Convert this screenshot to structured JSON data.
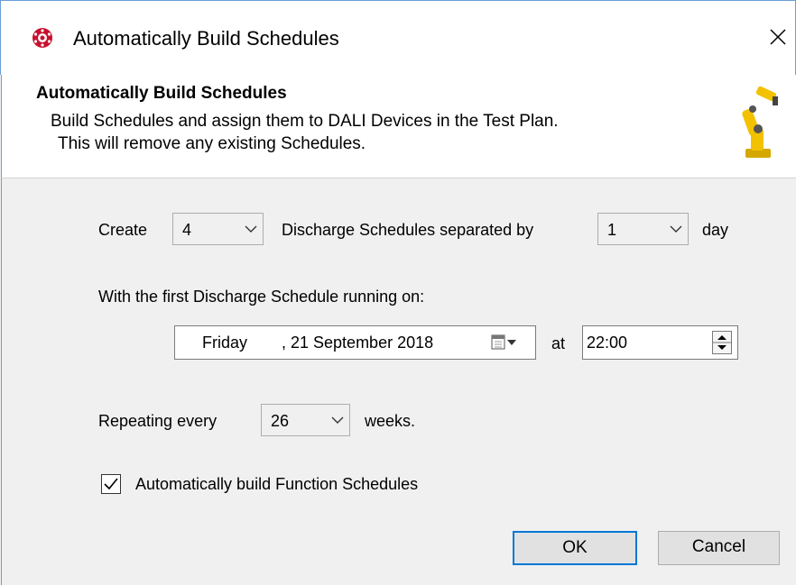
{
  "window": {
    "title": "Automatically Build Schedules",
    "close_icon": "close-icon",
    "app_icon": "dali-app-icon"
  },
  "header": {
    "title": "Automatically Build Schedules",
    "line1": "Build Schedules and assign them to DALI Devices in the Test Plan.",
    "line2": "This will remove any existing Schedules.",
    "icon": "robot-arm-icon"
  },
  "form": {
    "create_label": "Create",
    "count_value": "4",
    "separated_label": "Discharge Schedules separated by",
    "separation_value": "1",
    "day_label": "day",
    "first_schedule_label": "With the first Discharge Schedule running on:",
    "date_day": "Friday",
    "date_rest": ", 21 September 2018",
    "at_label": "at",
    "time_value": "22:00",
    "repeating_label": "Repeating every",
    "repeat_value": "26",
    "weeks_label": "weeks.",
    "auto_function_label": "Automatically build Function Schedules",
    "auto_function_checked": true
  },
  "buttons": {
    "ok": "OK",
    "cancel": "Cancel"
  },
  "colors": {
    "accent": "#0078d7",
    "window_border": "#6a9fd8",
    "app_icon": "#c8102e",
    "robot": "#f2c200"
  }
}
